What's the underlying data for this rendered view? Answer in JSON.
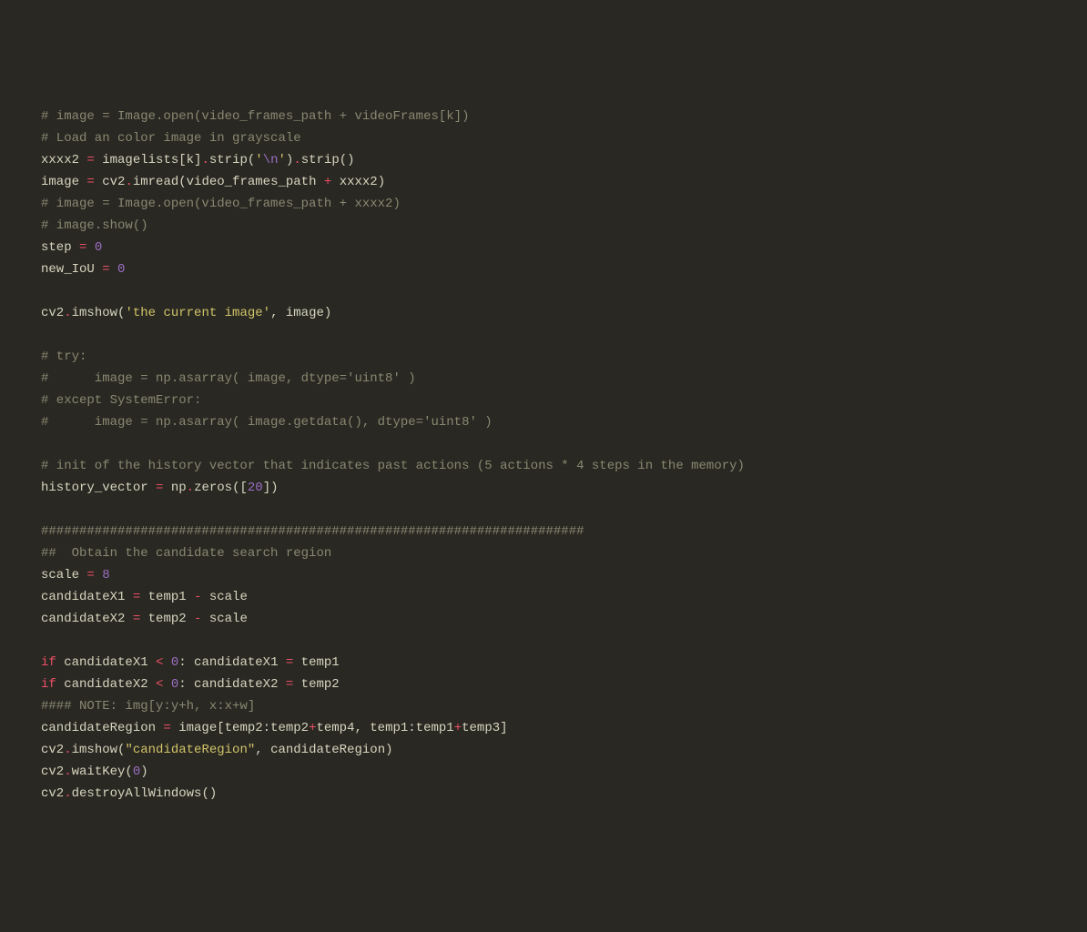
{
  "code": {
    "lines": [
      {
        "type": "comment",
        "text": "# image = Image.open(video_frames_path + videoFrames[k])"
      },
      {
        "type": "comment",
        "text": "# Load an color image in grayscale"
      },
      {
        "type": "code",
        "tokens": [
          {
            "c": "ident",
            "t": "xxxx2 "
          },
          {
            "c": "op",
            "t": "="
          },
          {
            "c": "ident",
            "t": " imagelists[k]"
          },
          {
            "c": "op",
            "t": "."
          },
          {
            "c": "ident",
            "t": "strip("
          },
          {
            "c": "string",
            "t": "'"
          },
          {
            "c": "escape",
            "t": "\\n"
          },
          {
            "c": "string",
            "t": "'"
          },
          {
            "c": "ident",
            "t": ")"
          },
          {
            "c": "op",
            "t": "."
          },
          {
            "c": "ident",
            "t": "strip()"
          }
        ]
      },
      {
        "type": "code",
        "tokens": [
          {
            "c": "ident",
            "t": "image "
          },
          {
            "c": "op",
            "t": "="
          },
          {
            "c": "ident",
            "t": " cv2"
          },
          {
            "c": "op",
            "t": "."
          },
          {
            "c": "ident",
            "t": "imread(video_frames_path "
          },
          {
            "c": "op",
            "t": "+"
          },
          {
            "c": "ident",
            "t": " xxxx2)"
          }
        ]
      },
      {
        "type": "comment",
        "text": "# image = Image.open(video_frames_path + xxxx2)"
      },
      {
        "type": "comment",
        "text": "# image.show()"
      },
      {
        "type": "code",
        "tokens": [
          {
            "c": "ident",
            "t": "step "
          },
          {
            "c": "op",
            "t": "="
          },
          {
            "c": "ident",
            "t": " "
          },
          {
            "c": "num",
            "t": "0"
          }
        ]
      },
      {
        "type": "code",
        "tokens": [
          {
            "c": "ident",
            "t": "new_IoU "
          },
          {
            "c": "op",
            "t": "="
          },
          {
            "c": "ident",
            "t": " "
          },
          {
            "c": "num",
            "t": "0"
          }
        ]
      },
      {
        "type": "blank",
        "text": ""
      },
      {
        "type": "code",
        "tokens": [
          {
            "c": "ident",
            "t": "cv2"
          },
          {
            "c": "op",
            "t": "."
          },
          {
            "c": "ident",
            "t": "imshow("
          },
          {
            "c": "string",
            "t": "'the current image'"
          },
          {
            "c": "ident",
            "t": ", image)"
          }
        ]
      },
      {
        "type": "blank",
        "text": ""
      },
      {
        "type": "comment",
        "text": "# try:"
      },
      {
        "type": "comment",
        "text": "#      image = np.asarray( image, dtype='uint8' )"
      },
      {
        "type": "comment",
        "text": "# except SystemError:"
      },
      {
        "type": "comment",
        "text": "#      image = np.asarray( image.getdata(), dtype='uint8' )"
      },
      {
        "type": "blank",
        "text": ""
      },
      {
        "type": "comment",
        "text": "# init of the history vector that indicates past actions (5 actions * 4 steps in the memory)"
      },
      {
        "type": "code",
        "tokens": [
          {
            "c": "ident",
            "t": "history_vector "
          },
          {
            "c": "op",
            "t": "="
          },
          {
            "c": "ident",
            "t": " np"
          },
          {
            "c": "op",
            "t": "."
          },
          {
            "c": "ident",
            "t": "zeros(["
          },
          {
            "c": "num",
            "t": "20"
          },
          {
            "c": "ident",
            "t": "])"
          }
        ]
      },
      {
        "type": "blank",
        "text": ""
      },
      {
        "type": "comment",
        "text": "#######################################################################"
      },
      {
        "type": "comment",
        "text": "##  Obtain the candidate search region"
      },
      {
        "type": "code",
        "tokens": [
          {
            "c": "ident",
            "t": "scale "
          },
          {
            "c": "op",
            "t": "="
          },
          {
            "c": "ident",
            "t": " "
          },
          {
            "c": "num",
            "t": "8"
          }
        ]
      },
      {
        "type": "code",
        "tokens": [
          {
            "c": "ident",
            "t": "candidateX1 "
          },
          {
            "c": "op",
            "t": "="
          },
          {
            "c": "ident",
            "t": " temp1 "
          },
          {
            "c": "op",
            "t": "-"
          },
          {
            "c": "ident",
            "t": " scale"
          }
        ]
      },
      {
        "type": "code",
        "tokens": [
          {
            "c": "ident",
            "t": "candidateX2 "
          },
          {
            "c": "op",
            "t": "="
          },
          {
            "c": "ident",
            "t": " temp2 "
          },
          {
            "c": "op",
            "t": "-"
          },
          {
            "c": "ident",
            "t": " scale"
          }
        ]
      },
      {
        "type": "blank",
        "text": ""
      },
      {
        "type": "code",
        "tokens": [
          {
            "c": "kw",
            "t": "if"
          },
          {
            "c": "ident",
            "t": " candidateX1 "
          },
          {
            "c": "op",
            "t": "<"
          },
          {
            "c": "ident",
            "t": " "
          },
          {
            "c": "num",
            "t": "0"
          },
          {
            "c": "ident",
            "t": ": candidateX1 "
          },
          {
            "c": "op",
            "t": "="
          },
          {
            "c": "ident",
            "t": " temp1"
          }
        ]
      },
      {
        "type": "code",
        "tokens": [
          {
            "c": "kw",
            "t": "if"
          },
          {
            "c": "ident",
            "t": " candidateX2 "
          },
          {
            "c": "op",
            "t": "<"
          },
          {
            "c": "ident",
            "t": " "
          },
          {
            "c": "num",
            "t": "0"
          },
          {
            "c": "ident",
            "t": ": candidateX2 "
          },
          {
            "c": "op",
            "t": "="
          },
          {
            "c": "ident",
            "t": " temp2"
          }
        ]
      },
      {
        "type": "comment",
        "text": "#### NOTE: img[y:y+h, x:x+w]"
      },
      {
        "type": "code",
        "tokens": [
          {
            "c": "ident",
            "t": "candidateRegion "
          },
          {
            "c": "op",
            "t": "="
          },
          {
            "c": "ident",
            "t": " image[temp2:temp2"
          },
          {
            "c": "op",
            "t": "+"
          },
          {
            "c": "ident",
            "t": "temp4, temp1:temp1"
          },
          {
            "c": "op",
            "t": "+"
          },
          {
            "c": "ident",
            "t": "temp3]"
          }
        ]
      },
      {
        "type": "code",
        "tokens": [
          {
            "c": "ident",
            "t": "cv2"
          },
          {
            "c": "op",
            "t": "."
          },
          {
            "c": "ident",
            "t": "imshow("
          },
          {
            "c": "string",
            "t": "\"candidateRegion\""
          },
          {
            "c": "ident",
            "t": ", candidateRegion)"
          }
        ]
      },
      {
        "type": "code",
        "tokens": [
          {
            "c": "ident",
            "t": "cv2"
          },
          {
            "c": "op",
            "t": "."
          },
          {
            "c": "ident",
            "t": "waitKey("
          },
          {
            "c": "num",
            "t": "0"
          },
          {
            "c": "ident",
            "t": ")"
          }
        ]
      },
      {
        "type": "code",
        "tokens": [
          {
            "c": "ident",
            "t": "cv2"
          },
          {
            "c": "op",
            "t": "."
          },
          {
            "c": "ident",
            "t": "destroyAllWindows()"
          }
        ]
      }
    ]
  }
}
